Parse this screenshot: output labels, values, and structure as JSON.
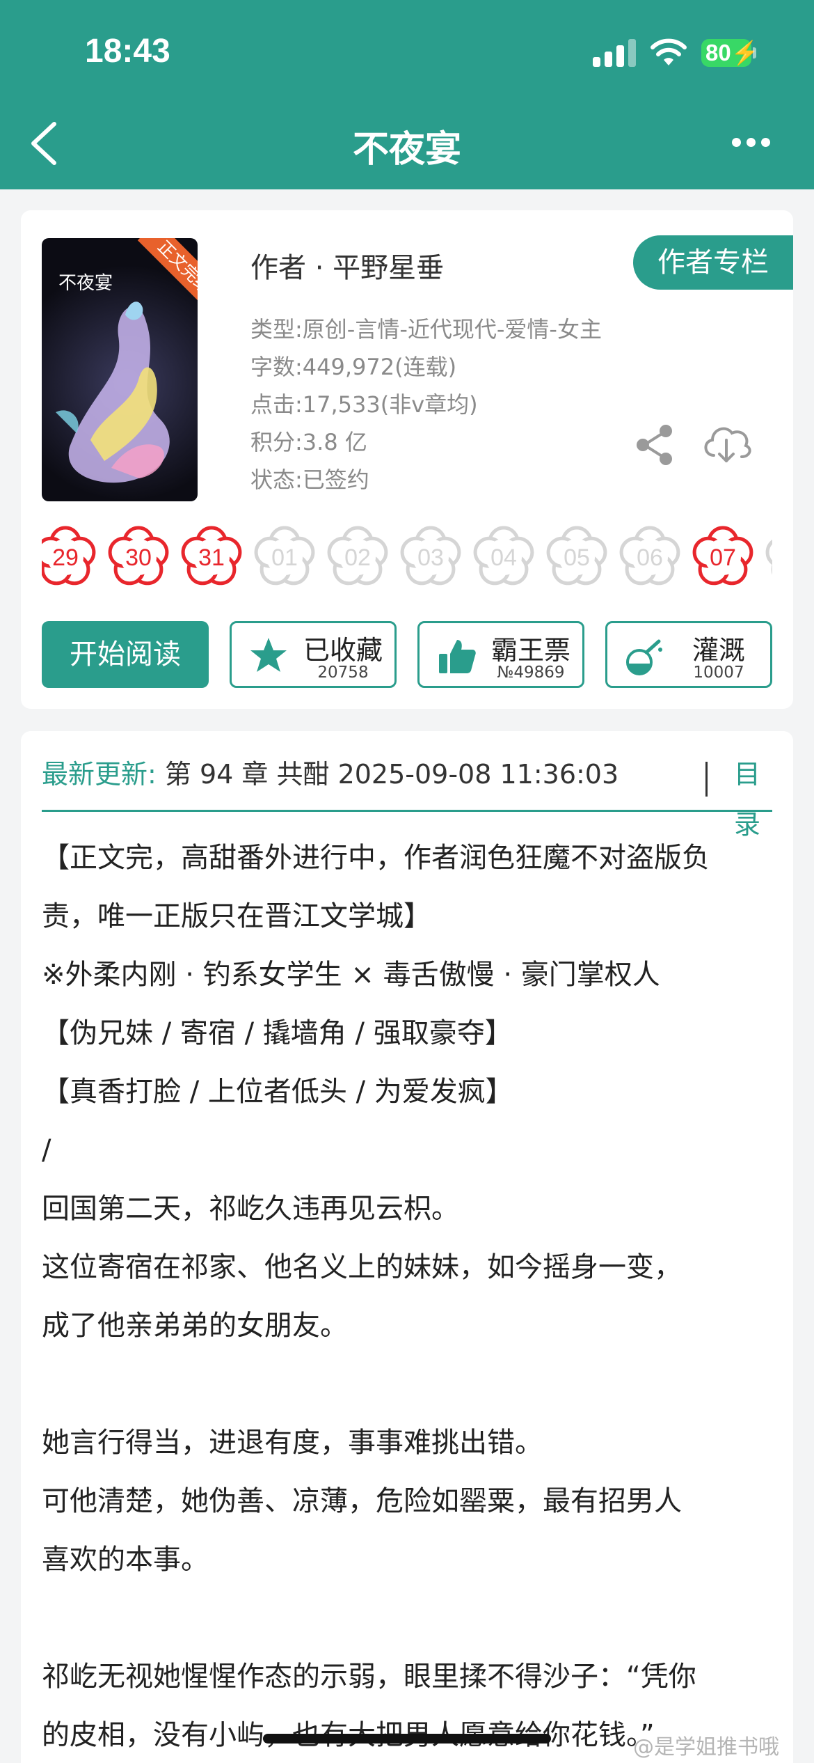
{
  "status_bar": {
    "time": "18:43",
    "battery": "80"
  },
  "nav": {
    "title": "不夜宴"
  },
  "book": {
    "cover_title": "不夜宴",
    "cover_ribbon": "正文完结",
    "author": "作者 · 平野星垂",
    "author_column_button": "作者专栏",
    "meta": [
      "类型:原创-言情-近代现代-爱情-女主",
      "字数:449,972(连载)",
      "点击:17,533(非v章均)",
      "积分:3.8 亿",
      "状态:已签约"
    ]
  },
  "calendar": {
    "days": [
      {
        "label": "29",
        "active": true
      },
      {
        "label": "30",
        "active": true
      },
      {
        "label": "31",
        "active": true
      },
      {
        "label": "01",
        "active": false
      },
      {
        "label": "02",
        "active": false
      },
      {
        "label": "03",
        "active": false
      },
      {
        "label": "04",
        "active": false
      },
      {
        "label": "05",
        "active": false
      },
      {
        "label": "06",
        "active": false
      },
      {
        "label": "07",
        "active": true
      }
    ],
    "active_color": "#e8262c",
    "inactive_color": "#d5d5d5"
  },
  "actions": {
    "read_button": "开始阅读",
    "collect": {
      "label": "已收藏",
      "count": "20758"
    },
    "ticket": {
      "label": "霸王票",
      "count": "№49869"
    },
    "nutrient": {
      "label": "灌溉",
      "count": "10007"
    }
  },
  "update": {
    "label": "最新更新:",
    "text": "第 94 章 共酣 2025-09-08 11:36:03",
    "toc_link": "目录"
  },
  "intro_lines": [
    "【正文完，高甜番外进行中，作者润色狂魔不对盗版负",
    "责，唯一正版只在晋江文学城】",
    "※外柔内刚 · 钓系女学生 × 毒舌傲慢 · 豪门掌权人",
    "【伪兄妹 / 寄宿 / 撬墙角 / 强取豪夺】",
    "【真香打脸 / 上位者低头 / 为爱发疯】",
    "/",
    "回国第二天，祁屹久违再见云枳。",
    "这位寄宿在祁家、他名义上的妹妹，如今摇身一变，",
    "成了他亲弟弟的女朋友。",
    "",
    "她言行得当，进退有度，事事难挑出错。",
    "可他清楚，她伪善、凉薄，危险如罂粟，最有招男人",
    "喜欢的本事。",
    "",
    "祁屹无视她惺惺作态的示弱，眼里揉不得沙子：“凭你",
    "的皮相，没有小屿，也有大把男人愿意给你花钱。”"
  ],
  "watermark": "@是学姐推书哦",
  "colors": {
    "accent": "#2a9d8c",
    "header_bg": "#2a9d8c"
  }
}
